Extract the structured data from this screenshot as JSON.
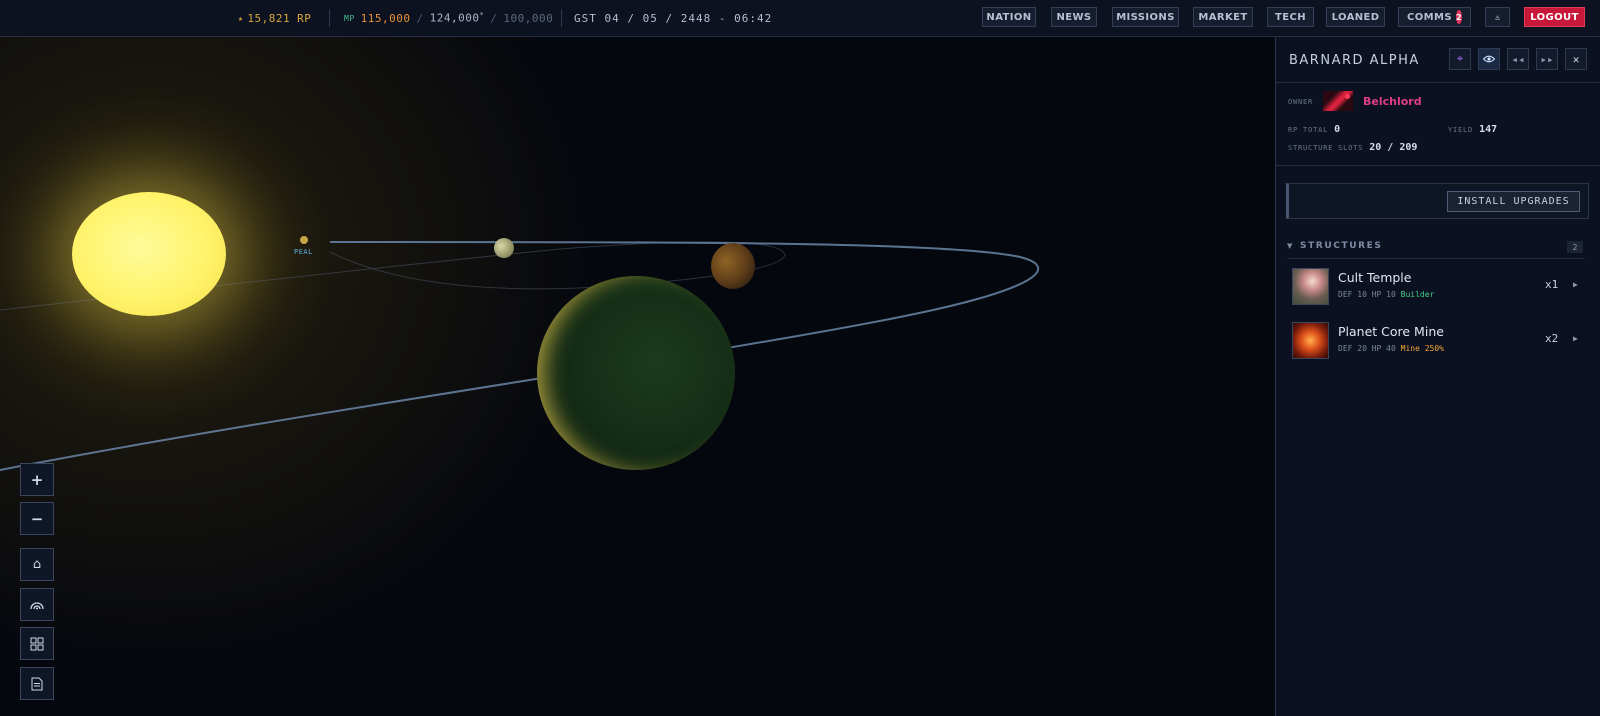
{
  "topbar": {
    "rp_value": "15,821 RP",
    "mp_label": "MP",
    "mp_current": "115,000",
    "mp_max": "124,000",
    "mp_cap": "100,000",
    "date": "GST 04 / 05 / 2448 - 06:42",
    "nav": {
      "nation": "NATION",
      "news": "NEWS",
      "missions": "MISSIONS",
      "market": "MARKET",
      "tech": "TECH",
      "loaned": "LOANED",
      "comms": "COMMS",
      "comms_badge": "2",
      "logout": "LOGOUT"
    }
  },
  "map": {
    "planet_label": "PEAL",
    "controls": {
      "zoom_in": "+",
      "zoom_out": "−"
    }
  },
  "panel": {
    "title": "BARNARD ALPHA",
    "owner_label": "OWNER",
    "owner_name": "Belchlord",
    "rp_total_label": "RP TOTAL",
    "rp_total": "0",
    "yield_label": "YIELD",
    "yield": "147",
    "slots_label": "STRUCTURE SLOTS",
    "slots": "20 / 209",
    "install_label": "INSTALL UPGRADES",
    "structures_label": "STRUCTURES",
    "structures_count": "2",
    "structures": [
      {
        "name": "Cult Temple",
        "stats": "DEF 10  HP 10",
        "tag": "Builder",
        "qty": "x1"
      },
      {
        "name": "Planet Core Mine",
        "stats": "DEF 20  HP 40",
        "tag": "Mine 250%",
        "qty": "x2"
      }
    ]
  },
  "colors": {
    "accent_gold": "#d9a63a",
    "logout_red": "#c8183a",
    "owner_pink": "#e23c8c",
    "tag_green": "#49d08a",
    "tag_orange": "#f2a336"
  }
}
